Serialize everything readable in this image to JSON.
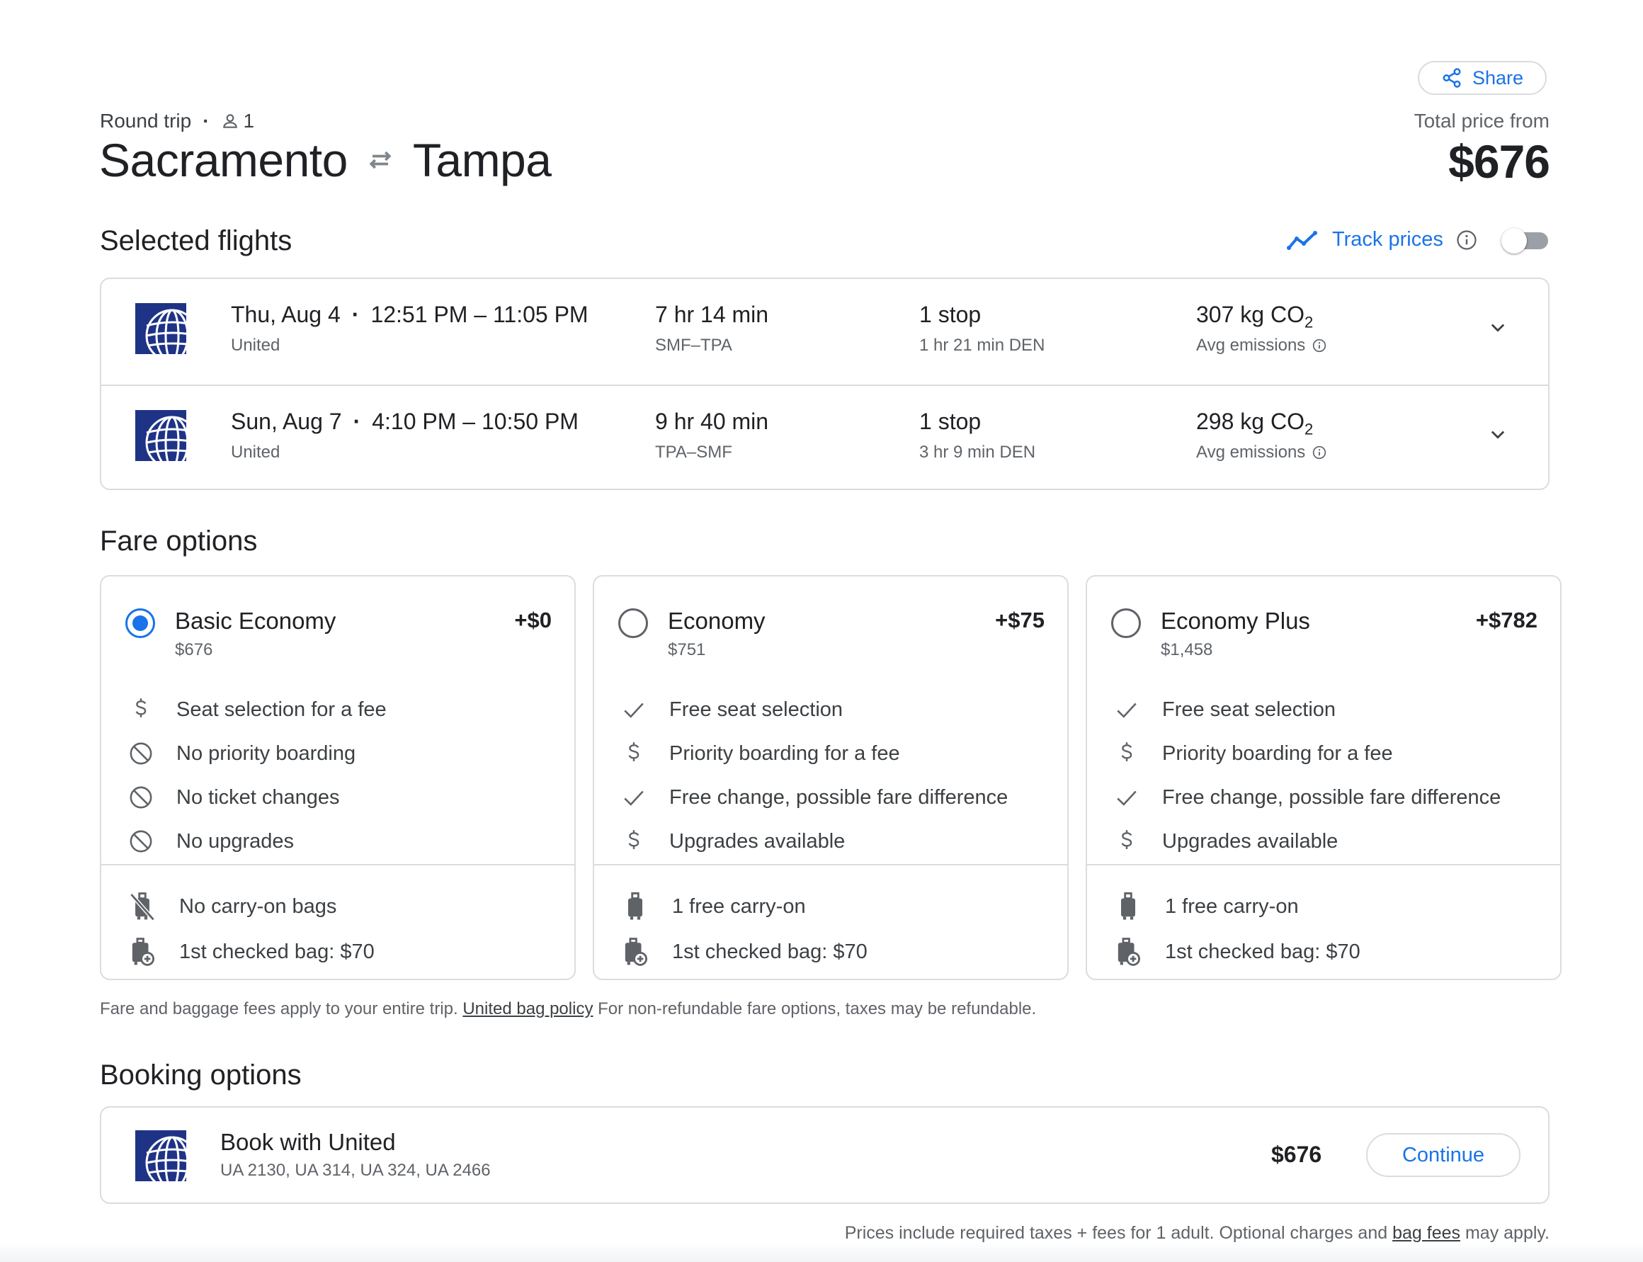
{
  "header": {
    "share_label": "Share",
    "trip_type": "Round trip",
    "separator": "·",
    "passengers": "1",
    "origin": "Sacramento",
    "destination": "Tampa",
    "total_label": "Total price from",
    "total_price": "$676"
  },
  "selected_flights": {
    "title": "Selected flights",
    "track_prices_label": "Track prices",
    "track_prices_on": false,
    "flights": [
      {
        "date": "Thu, Aug 4",
        "sep": "·",
        "times": "12:51 PM – 11:05 PM",
        "airline": "United",
        "duration": "7 hr 14 min",
        "route": "SMF–TPA",
        "stops": "1 stop",
        "layover": "1 hr 21 min DEN",
        "emissions_value": "307 kg CO",
        "emissions_sub": "2",
        "emissions_label": "Avg emissions"
      },
      {
        "date": "Sun, Aug 7",
        "sep": "·",
        "times": "4:10 PM – 10:50 PM",
        "airline": "United",
        "duration": "9 hr 40 min",
        "route": "TPA–SMF",
        "stops": "1 stop",
        "layover": "3 hr 9 min DEN",
        "emissions_value": "298 kg CO",
        "emissions_sub": "2",
        "emissions_label": "Avg emissions"
      }
    ]
  },
  "fare_options": {
    "title": "Fare options",
    "fares": [
      {
        "name": "Basic Economy",
        "price": "$676",
        "diff": "+$0",
        "selected": true,
        "features": [
          {
            "icon": "dollar-icon",
            "text": "Seat selection for a fee"
          },
          {
            "icon": "block-icon",
            "text": "No priority boarding"
          },
          {
            "icon": "block-icon",
            "text": "No ticket changes"
          },
          {
            "icon": "block-icon",
            "text": "No upgrades"
          }
        ],
        "bags": [
          {
            "icon": "no-bag-icon",
            "text": "No carry-on bags"
          },
          {
            "icon": "checked-bag-icon",
            "text": "1st checked bag: $70"
          }
        ]
      },
      {
        "name": "Economy",
        "price": "$751",
        "diff": "+$75",
        "selected": false,
        "features": [
          {
            "icon": "check-icon",
            "text": "Free seat selection"
          },
          {
            "icon": "dollar-icon",
            "text": "Priority boarding for a fee"
          },
          {
            "icon": "check-icon",
            "text": "Free change, possible fare difference"
          },
          {
            "icon": "dollar-icon",
            "text": "Upgrades available"
          }
        ],
        "bags": [
          {
            "icon": "carry-on-icon",
            "text": "1 free carry-on"
          },
          {
            "icon": "checked-bag-icon",
            "text": "1st checked bag: $70"
          }
        ]
      },
      {
        "name": "Economy Plus",
        "price": "$1,458",
        "diff": "+$782",
        "selected": false,
        "features": [
          {
            "icon": "check-icon",
            "text": "Free seat selection"
          },
          {
            "icon": "dollar-icon",
            "text": "Priority boarding for a fee"
          },
          {
            "icon": "check-icon",
            "text": "Free change, possible fare difference"
          },
          {
            "icon": "dollar-icon",
            "text": "Upgrades available"
          }
        ],
        "bags": [
          {
            "icon": "carry-on-icon",
            "text": "1 free carry-on"
          },
          {
            "icon": "checked-bag-icon",
            "text": "1st checked bag: $70"
          }
        ]
      }
    ],
    "note_before": "Fare and baggage fees apply to your entire trip.",
    "note_link": "United bag policy",
    "note_after": "For non-refundable fare options, taxes may be refundable."
  },
  "booking_options": {
    "title": "Booking options",
    "provider": "Book with United",
    "flight_numbers": "UA 2130, UA 314, UA 324, UA 2466",
    "price": "$676",
    "continue_label": "Continue",
    "note_before": "Prices include required taxes + fees for 1 adult. Optional charges and",
    "note_link": "bag fees",
    "note_after": "may apply."
  },
  "colors": {
    "accent": "#1a73e8",
    "united_blue": "#1f3386",
    "border": "#dadce0"
  }
}
